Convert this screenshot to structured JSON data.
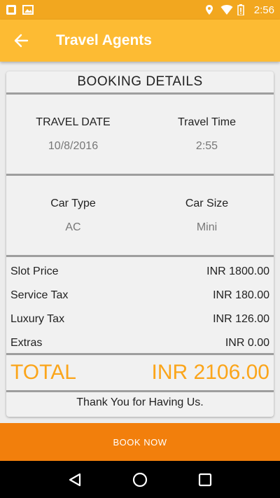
{
  "status_bar": {
    "time": "2:56"
  },
  "app_bar": {
    "title": "Travel Agents"
  },
  "booking": {
    "heading": "BOOKING DETAILS",
    "travel_date_label": "TRAVEL DATE",
    "travel_date_value": "10/8/2016",
    "travel_time_label": "Travel Time",
    "travel_time_value": "2:55",
    "car_type_label": "Car Type",
    "car_type_value": "AC",
    "car_size_label": "Car Size",
    "car_size_value": "Mini",
    "prices": [
      {
        "label": "Slot Price",
        "value": "INR 1800.00"
      },
      {
        "label": "Service Tax",
        "value": "INR 180.00"
      },
      {
        "label": "Luxury Tax",
        "value": "INR 126.00"
      },
      {
        "label": "Extras",
        "value": "INR 0.00"
      }
    ],
    "total_label": "TOTAL",
    "total_value": "INR 2106.00",
    "thanks": "Thank You for Having Us."
  },
  "book_button": {
    "label": "BOOK NOW"
  },
  "colors": {
    "status_bar": "#f2a71f",
    "app_bar": "#fdbb33",
    "accent": "#fba51a",
    "book_button": "#f27f0c"
  },
  "icons": [
    "notification-icon",
    "image-icon",
    "location-icon",
    "wifi-icon",
    "battery-icon",
    "back-arrow-icon",
    "nav-back-icon",
    "nav-home-icon",
    "nav-recents-icon"
  ]
}
